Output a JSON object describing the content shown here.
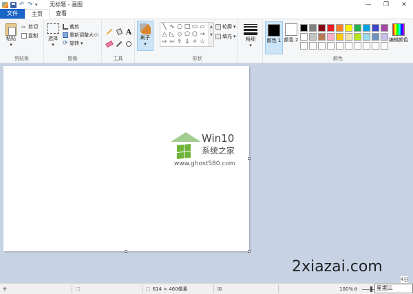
{
  "window": {
    "title": "无标题 - 画图",
    "controls": [
      "—",
      "❐",
      "✕"
    ]
  },
  "tabs": {
    "file": "文件",
    "home": "主页",
    "view": "查看"
  },
  "ribbon": {
    "clipboard": {
      "label": "剪贴板",
      "paste": "粘贴",
      "cut": "剪切",
      "copy": "复制"
    },
    "image": {
      "label": "图像",
      "select": "选择",
      "crop": "裁剪",
      "resize": "重新调整大小",
      "rotate": "旋转"
    },
    "tools": {
      "label": "工具",
      "text_glyph": "A"
    },
    "brushes": {
      "label": "刷子"
    },
    "shapes": {
      "label": "形状",
      "outline": "轮廓",
      "fill": "填充",
      "glyphs": [
        "╲",
        "∿",
        "○",
        "□",
        "▭",
        "▱",
        "△",
        "◺",
        "◇",
        "⬠",
        "⬡",
        "→",
        "⇨",
        "⇦",
        "⇧",
        "⇩",
        "✧",
        "☆",
        "✶",
        "▢",
        "▢",
        "○",
        "▭",
        "⬭"
      ]
    },
    "size": {
      "label": "粗细"
    },
    "colors": {
      "label": "颜色",
      "color1_label": "颜色 1",
      "color2_label": "颜色 2",
      "color1": "#000000",
      "color2": "#ffffff",
      "edit_colors": "编辑颜色",
      "palette": [
        "#000000",
        "#7f7f7f",
        "#880015",
        "#ed1c24",
        "#ff7f27",
        "#fff200",
        "#22b14c",
        "#00a2e8",
        "#3f48cc",
        "#a349a4",
        "#ffffff",
        "#c3c3c3",
        "#b97a57",
        "#ffaec9",
        "#ffc90e",
        "#efe4b0",
        "#b5e61d",
        "#99d9ea",
        "#7092be",
        "#c8bfe7",
        "#ffffff",
        "#ffffff",
        "#ffffff",
        "#ffffff",
        "#ffffff",
        "#ffffff",
        "#ffffff",
        "#ffffff",
        "#ffffff",
        "#ffffff"
      ]
    }
  },
  "canvas": {
    "watermark_title": "Win10",
    "watermark_subtitle": "系统之家",
    "watermark_url": "www.ghost580.com"
  },
  "site_watermark": "2xiazai.com",
  "statusbar": {
    "canvas_size": "614 × 460像素",
    "zoom": "100%",
    "tooltip": "星期三",
    "tooltip_fragment": "4日"
  }
}
